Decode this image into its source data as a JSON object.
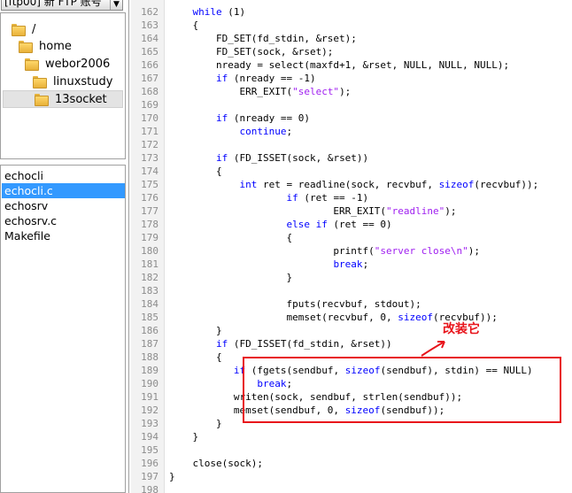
{
  "account_selector": {
    "value": "[ftp00] 新 FTP 账号"
  },
  "folder_tree": [
    {
      "label": "/",
      "indent": 0
    },
    {
      "label": "home",
      "indent": 1
    },
    {
      "label": "webor2006",
      "indent": 2
    },
    {
      "label": "linuxstudy",
      "indent": 3
    },
    {
      "label": "13socket",
      "indent": 4,
      "selected": true
    }
  ],
  "files": [
    {
      "name": "echocli"
    },
    {
      "name": "echocli.c",
      "selected": true
    },
    {
      "name": "echosrv"
    },
    {
      "name": "echosrv.c"
    },
    {
      "name": "Makefile"
    }
  ],
  "annotation": {
    "text": "改装它"
  },
  "colors": {
    "keyword": "#0000ff",
    "string": "#a020f0",
    "highlight": "#e8141b",
    "selection": "#3399ff"
  },
  "code_lines": [
    {
      "n": "162",
      "segs": [
        [
          "    ",
          ""
        ],
        [
          "while",
          "kw"
        ],
        [
          " (1)",
          ""
        ]
      ]
    },
    {
      "n": "163",
      "segs": [
        [
          "    {",
          ""
        ]
      ]
    },
    {
      "n": "164",
      "segs": [
        [
          "        FD_SET(fd_stdin, &rset);",
          ""
        ]
      ]
    },
    {
      "n": "165",
      "segs": [
        [
          "        FD_SET(sock, &rset);",
          ""
        ]
      ]
    },
    {
      "n": "166",
      "segs": [
        [
          "        nready = select(maxfd+1, &rset, NULL, NULL, NULL);",
          ""
        ]
      ]
    },
    {
      "n": "167",
      "segs": [
        [
          "        ",
          ""
        ],
        [
          "if",
          "kw"
        ],
        [
          " (nready == -1)",
          ""
        ]
      ]
    },
    {
      "n": "168",
      "segs": [
        [
          "            ERR_EXIT(",
          ""
        ],
        [
          "\"select\"",
          "str"
        ],
        [
          ");",
          ""
        ]
      ]
    },
    {
      "n": "169",
      "segs": [
        [
          "",
          ""
        ]
      ]
    },
    {
      "n": "170",
      "segs": [
        [
          "        ",
          ""
        ],
        [
          "if",
          "kw"
        ],
        [
          " (nready == 0)",
          ""
        ]
      ]
    },
    {
      "n": "171",
      "segs": [
        [
          "            ",
          ""
        ],
        [
          "continue",
          "kw"
        ],
        [
          ";",
          ""
        ]
      ]
    },
    {
      "n": "172",
      "segs": [
        [
          "",
          ""
        ]
      ]
    },
    {
      "n": "173",
      "segs": [
        [
          "        ",
          ""
        ],
        [
          "if",
          "kw"
        ],
        [
          " (FD_ISSET(sock, &rset))",
          ""
        ]
      ]
    },
    {
      "n": "174",
      "segs": [
        [
          "        {",
          ""
        ]
      ]
    },
    {
      "n": "175",
      "segs": [
        [
          "            ",
          ""
        ],
        [
          "int",
          "kw"
        ],
        [
          " ret = readline(sock, recvbuf, ",
          ""
        ],
        [
          "sizeof",
          "kw"
        ],
        [
          "(recvbuf));",
          ""
        ]
      ]
    },
    {
      "n": "176",
      "segs": [
        [
          "                    ",
          ""
        ],
        [
          "if",
          "kw"
        ],
        [
          " (ret == -1)",
          ""
        ]
      ]
    },
    {
      "n": "177",
      "segs": [
        [
          "                            ERR_EXIT(",
          ""
        ],
        [
          "\"readline\"",
          "str"
        ],
        [
          ");",
          ""
        ]
      ]
    },
    {
      "n": "178",
      "segs": [
        [
          "                    ",
          ""
        ],
        [
          "else if",
          "kw"
        ],
        [
          " (ret == 0)",
          ""
        ]
      ]
    },
    {
      "n": "179",
      "segs": [
        [
          "                    {",
          ""
        ]
      ]
    },
    {
      "n": "180",
      "segs": [
        [
          "                            printf(",
          ""
        ],
        [
          "\"server close\\n\"",
          "str"
        ],
        [
          ");",
          ""
        ]
      ]
    },
    {
      "n": "181",
      "segs": [
        [
          "                            ",
          ""
        ],
        [
          "break",
          "kw"
        ],
        [
          ";",
          ""
        ]
      ]
    },
    {
      "n": "182",
      "segs": [
        [
          "                    }",
          ""
        ]
      ]
    },
    {
      "n": "183",
      "segs": [
        [
          "",
          ""
        ]
      ]
    },
    {
      "n": "184",
      "segs": [
        [
          "                    fputs(recvbuf, stdout);",
          ""
        ]
      ]
    },
    {
      "n": "185",
      "segs": [
        [
          "                    memset(recvbuf, 0, ",
          ""
        ],
        [
          "sizeof",
          "kw"
        ],
        [
          "(recvbuf));",
          ""
        ]
      ]
    },
    {
      "n": "186",
      "segs": [
        [
          "        }",
          ""
        ]
      ]
    },
    {
      "n": "187",
      "segs": [
        [
          "        ",
          ""
        ],
        [
          "if",
          "kw"
        ],
        [
          " (FD_ISSET(fd_stdin, &rset))",
          ""
        ]
      ]
    },
    {
      "n": "188",
      "segs": [
        [
          "        {",
          ""
        ]
      ]
    },
    {
      "n": "189",
      "segs": [
        [
          "           ",
          ""
        ],
        [
          "if",
          "kw"
        ],
        [
          " (fgets(sendbuf, ",
          ""
        ],
        [
          "sizeof",
          "kw"
        ],
        [
          "(sendbuf), stdin) == NULL)",
          ""
        ]
      ]
    },
    {
      "n": "190",
      "segs": [
        [
          "               ",
          ""
        ],
        [
          "break",
          "kw"
        ],
        [
          ";",
          ""
        ]
      ]
    },
    {
      "n": "191",
      "segs": [
        [
          "           writen(sock, sendbuf, strlen(sendbuf));",
          ""
        ]
      ]
    },
    {
      "n": "192",
      "segs": [
        [
          "           memset(sendbuf, 0, ",
          ""
        ],
        [
          "sizeof",
          "kw"
        ],
        [
          "(sendbuf));",
          ""
        ]
      ]
    },
    {
      "n": "193",
      "segs": [
        [
          "        }",
          ""
        ]
      ]
    },
    {
      "n": "194",
      "segs": [
        [
          "    }",
          ""
        ]
      ]
    },
    {
      "n": "195",
      "segs": [
        [
          "",
          ""
        ]
      ]
    },
    {
      "n": "196",
      "segs": [
        [
          "    close(sock);",
          ""
        ]
      ]
    },
    {
      "n": "197",
      "segs": [
        [
          "}",
          ""
        ]
      ]
    },
    {
      "n": "198",
      "segs": [
        [
          "",
          ""
        ]
      ]
    }
  ]
}
